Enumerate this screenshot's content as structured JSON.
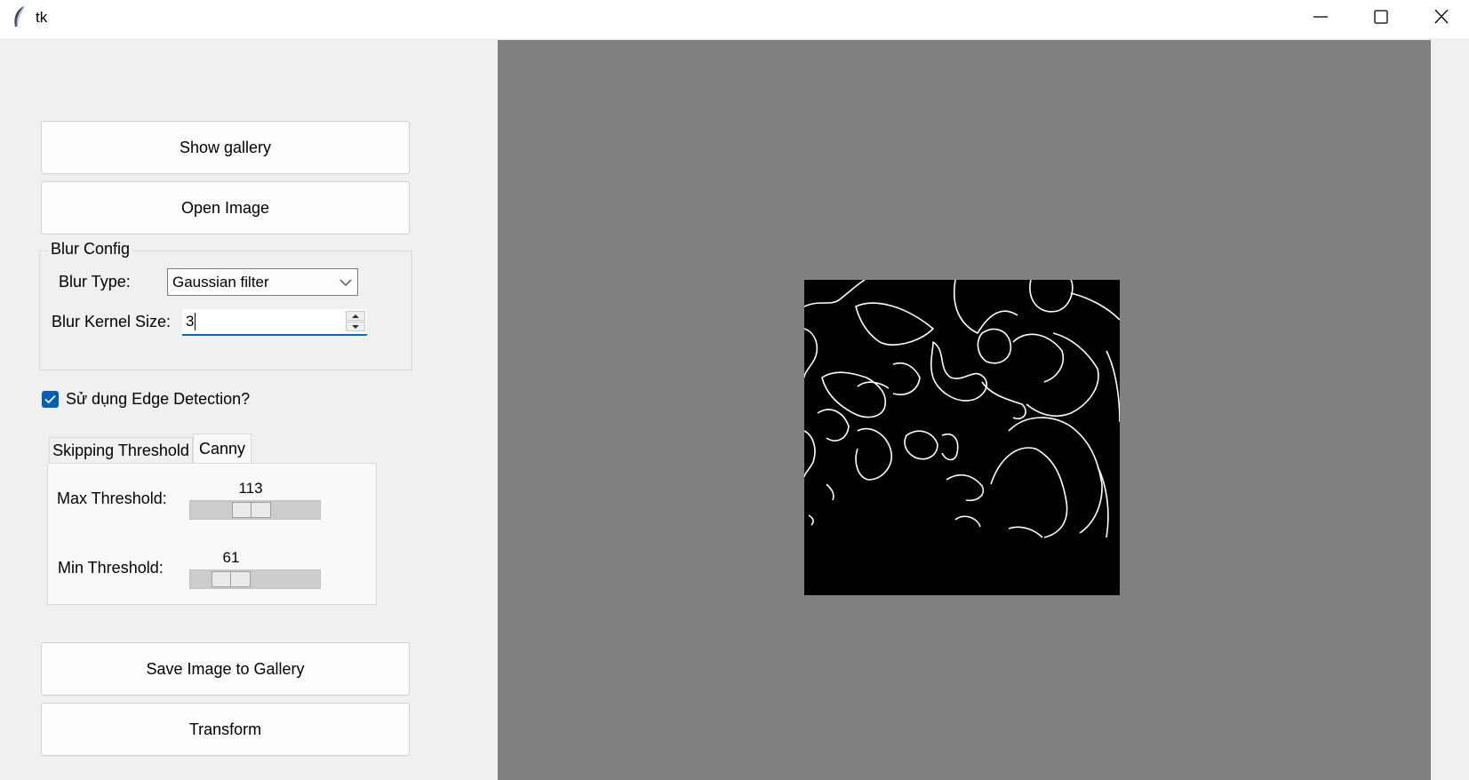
{
  "window": {
    "title": "tk",
    "icons": {
      "app": "feather-icon",
      "minimize": "minimize-icon",
      "maximize": "maximize-icon",
      "close": "close-icon"
    }
  },
  "buttons": {
    "show_gallery": "Show gallery",
    "open_image": "Open Image",
    "save_image": "Save Image to Gallery",
    "transform": "Transform"
  },
  "blur_config": {
    "title": "Blur Config",
    "type_label": "Blur Type:",
    "type_value": "Gaussian filter",
    "kernel_label": "Blur Kernel Size:",
    "kernel_value": "3"
  },
  "edge_detection": {
    "checkbox_label": "Sử dụng Edge Detection?",
    "checked": true,
    "tabs": [
      "Skipping Threshold",
      "Canny"
    ],
    "active_tab": "Canny",
    "max_label": "Max Threshold:",
    "max_value": 113,
    "min_label": "Min Threshold:",
    "min_value": 61
  },
  "colors": {
    "panel_bg": "#f0f0f0",
    "canvas_bg": "#808080",
    "image_bg": "#000000",
    "edge_lines": "#ffffff",
    "accent": "#005fb8"
  }
}
